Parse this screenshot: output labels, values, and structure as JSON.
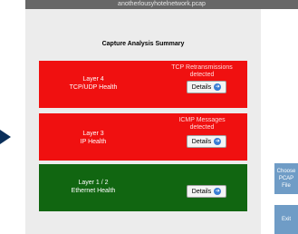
{
  "window": {
    "title": "anotherlousyhotelnetwork.pcap"
  },
  "summary_title": "Capture Analysis Summary",
  "panels": {
    "layer4": {
      "label_line1": "Layer 4",
      "label_line2": "TCP/UDP Health",
      "status_line1": "TCP Retransmissions",
      "status_line2": "detected",
      "button_label": "Details",
      "color": "#f01010"
    },
    "layer3": {
      "label_line1": "Layer 3",
      "label_line2": "IP Health",
      "status_line1": "ICMP Messages",
      "status_line2": "detected",
      "button_label": "Details",
      "color": "#f01010"
    },
    "layer12": {
      "label_line1": "Layer 1 / 2",
      "label_line2": "Ethernet Health",
      "button_label": "Details",
      "color": "#116611"
    }
  },
  "side_buttons": {
    "choose_label": "Choose PCAP File",
    "exit_label": "Exit"
  },
  "icons": {
    "details": "arrow-right-circle-icon",
    "nav": "triangle-right-icon"
  }
}
